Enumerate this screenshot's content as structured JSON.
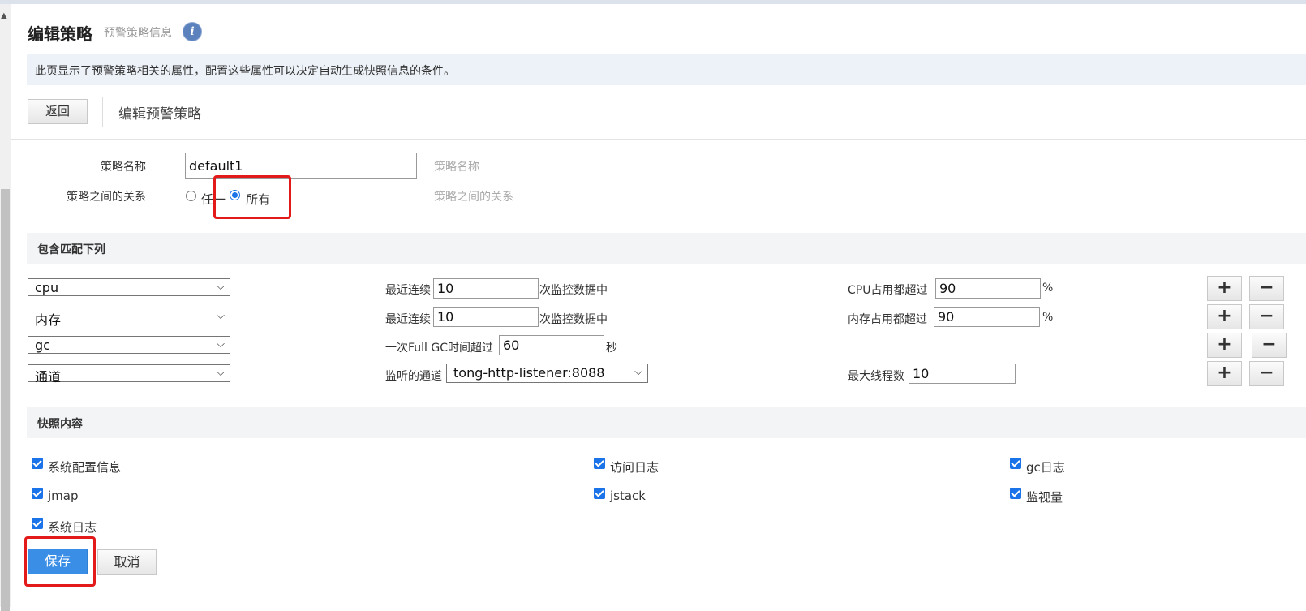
{
  "page": {
    "title": "编辑策略",
    "subtitle": "预警策略信息",
    "info_icon": "i",
    "description": "此页显示了预警策略相关的属性，配置这些属性可以决定自动生成快照信息的条件。"
  },
  "toolbar": {
    "back_label": "返回",
    "title": "编辑预警策略"
  },
  "form": {
    "name_label": "策略名称",
    "name_value": "default1",
    "name_hint": "策略名称",
    "relation_label": "策略之间的关系",
    "relation_options": [
      "任一",
      "所有"
    ],
    "relation_selected": "所有",
    "relation_hint": "策略之间的关系"
  },
  "match_section": {
    "title": "包含匹配下列",
    "rules": [
      {
        "type": "cpu",
        "cond_prefix": "最近连续",
        "cond_value": "10",
        "cond_suffix": "次监控数据中",
        "thr_label": "CPU占用都超过",
        "thr_value": "90",
        "thr_unit": "%"
      },
      {
        "type": "内存",
        "cond_prefix": "最近连续",
        "cond_value": "10",
        "cond_suffix": "次监控数据中",
        "thr_label": "内存占用都超过",
        "thr_value": "90",
        "thr_unit": "%"
      },
      {
        "type": "gc",
        "cond_prefix": "一次Full GC时间超过",
        "cond_value": "60",
        "cond_suffix": "秒"
      },
      {
        "type": "通道",
        "cond_prefix": "监听的通道",
        "channel": "tong-http-listener:8088",
        "thr_label": "最大线程数",
        "thr_value": "10"
      }
    ],
    "add_symbol": "+",
    "remove_symbol": "−"
  },
  "snapshot_section": {
    "title": "快照内容",
    "items": [
      {
        "label": "系统配置信息",
        "checked": true
      },
      {
        "label": "访问日志",
        "checked": true
      },
      {
        "label": "gc日志",
        "checked": true
      },
      {
        "label": "jmap",
        "checked": true
      },
      {
        "label": "jstack",
        "checked": true
      },
      {
        "label": "监视量",
        "checked": true
      },
      {
        "label": "系统日志",
        "checked": true
      }
    ]
  },
  "actions": {
    "save_label": "保存",
    "cancel_label": "取消"
  },
  "colors": {
    "accent": "#3a8ee6",
    "highlight_box": "#e21a1a",
    "description_bg": "#edf2f8"
  }
}
